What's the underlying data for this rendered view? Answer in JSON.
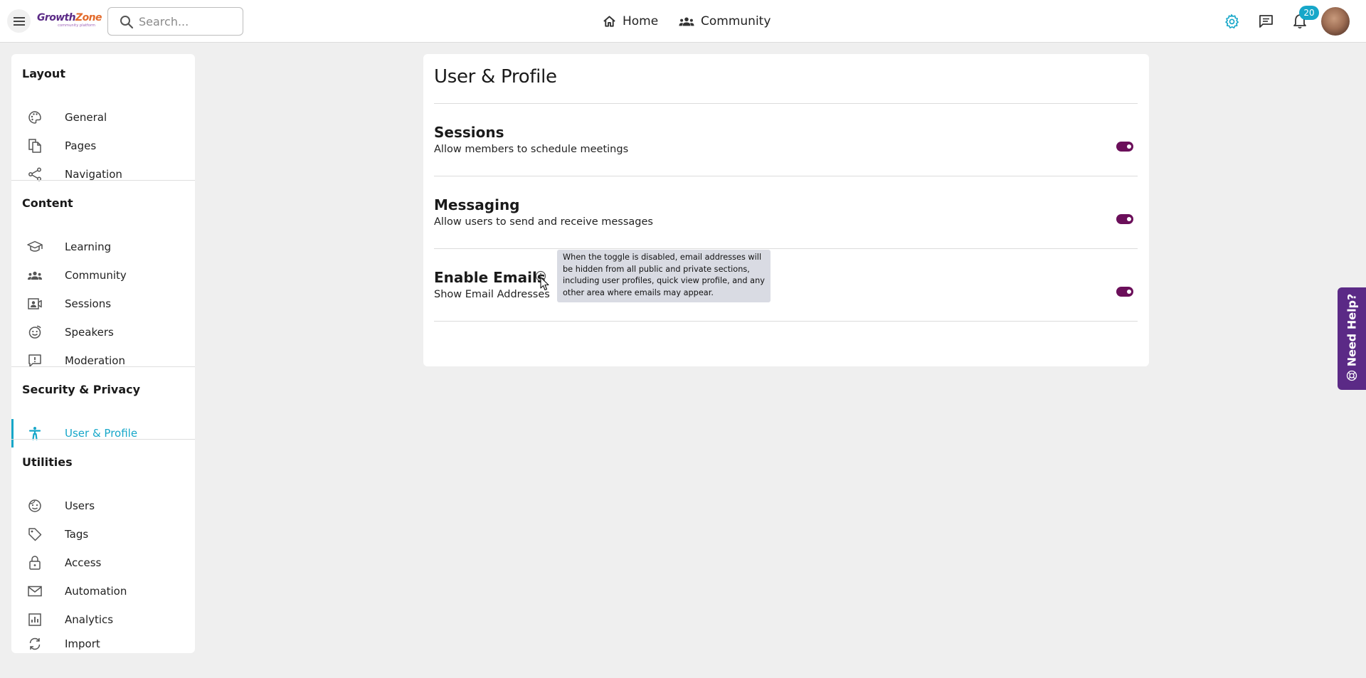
{
  "header": {
    "logo_text_a": "Growth",
    "logo_text_b": "Zone",
    "logo_sub": "community platform",
    "search_placeholder": "Search...",
    "nav": [
      {
        "label": "Home"
      },
      {
        "label": "Community"
      }
    ],
    "notification_count": "20",
    "settings_color": "#17a7c9"
  },
  "sidebar": {
    "sections": [
      {
        "title": "Layout",
        "items": [
          {
            "label": "General",
            "icon": "palette-icon"
          },
          {
            "label": "Pages",
            "icon": "pages-icon"
          },
          {
            "label": "Navigation",
            "icon": "share-icon"
          }
        ]
      },
      {
        "title": "Content",
        "items": [
          {
            "label": "Learning",
            "icon": "graduation-cap-icon"
          },
          {
            "label": "Community",
            "icon": "people-icon"
          },
          {
            "label": "Sessions",
            "icon": "video-user-icon"
          },
          {
            "label": "Speakers",
            "icon": "smile-icon"
          },
          {
            "label": "Moderation",
            "icon": "report-icon"
          }
        ]
      },
      {
        "title": "Security & Privacy",
        "items": [
          {
            "label": "User & Profile",
            "icon": "accessibility-icon",
            "active": true
          }
        ]
      },
      {
        "title": "Utilities",
        "items": [
          {
            "label": "Users",
            "icon": "face-icon"
          },
          {
            "label": "Tags",
            "icon": "tag-icon"
          },
          {
            "label": "Access",
            "icon": "lock-icon"
          },
          {
            "label": "Automation",
            "icon": "mail-icon"
          },
          {
            "label": "Analytics",
            "icon": "chart-icon"
          },
          {
            "label": "Import",
            "icon": "sync-icon"
          }
        ]
      }
    ]
  },
  "main": {
    "title": "User & Profile",
    "settings": [
      {
        "title": "Sessions",
        "description": "Allow members to schedule meetings",
        "enabled": true
      },
      {
        "title": "Messaging",
        "description": "Allow users to send and receive messages",
        "enabled": true
      },
      {
        "title": "Enable Emails",
        "description": "Show Email Addresses",
        "enabled": true
      }
    ],
    "tooltip": "When the toggle is disabled, email addresses will be hidden from all public and private sections, including user profiles, quick view profile, and any other area where emails may appear.",
    "toggle_color": "#6b0f5a",
    "accent_color": "#17a7c9"
  },
  "help_tab": {
    "label": "Need Help?",
    "color": "#5b2a86"
  }
}
